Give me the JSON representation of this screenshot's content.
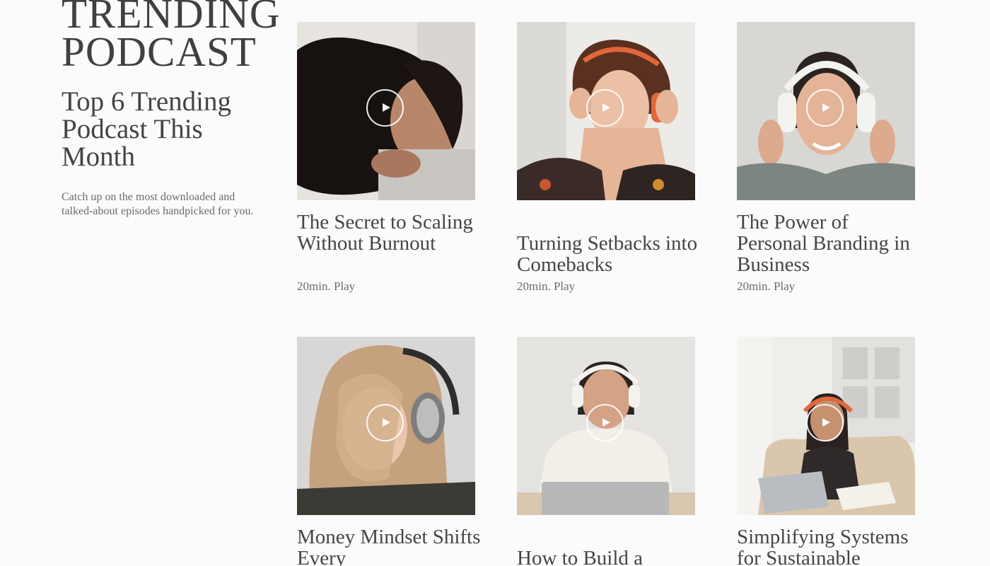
{
  "intro": {
    "title_line1": "TRENDING",
    "title_line2": "PODCAST",
    "subtitle": "Top 6 Trending Podcast This Month",
    "description": "Catch up on the most downloaded and talked-about episodes handpicked for you."
  },
  "episodes": [
    {
      "title": "The Secret to Scaling Without Burnout",
      "meta": "20min. Play",
      "palette": {
        "bg": "#e6e3df",
        "accent": "#1c1714",
        "skin": "#b7866a"
      }
    },
    {
      "title": "Turning Setbacks into Comebacks",
      "meta": "20min. Play",
      "palette": {
        "bg": "#e9e7e4",
        "accent": "#e0673a",
        "skin": "#e8b99d"
      }
    },
    {
      "title": "The Power of Personal Branding in Business",
      "meta": "20min. Play",
      "palette": {
        "bg": "#d8d6d3",
        "accent": "#f1f1ef",
        "skin": "#d9a98c"
      }
    },
    {
      "title": "Money Mindset Shifts Every",
      "meta": "",
      "palette": {
        "bg": "#d7d6d4",
        "accent": "#3a3a3a",
        "skin": "#e4bb9f"
      }
    },
    {
      "title": "How to Build a",
      "meta": "",
      "palette": {
        "bg": "#e3e2df",
        "accent": "#f3efe8",
        "skin": "#c99474"
      }
    },
    {
      "title": "Simplifying Systems for Sustainable",
      "meta": "",
      "palette": {
        "bg": "#ecebe7",
        "accent": "#e2673e",
        "skin": "#c18e6f"
      }
    }
  ]
}
